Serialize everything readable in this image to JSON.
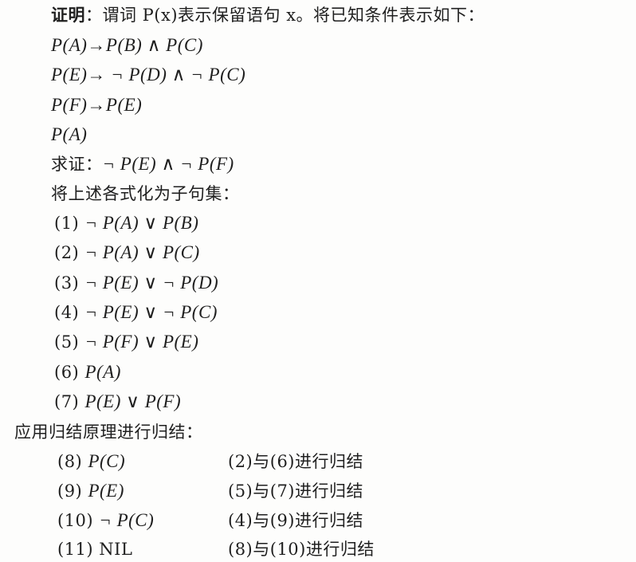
{
  "proof": {
    "heading_label": "证明",
    "heading_text": "：谓词 P(x)表示保留语句 x。将已知条件表示如下：",
    "premises": [
      "P(A)→P(B) ∧ P(C)",
      "P(E)→ ¬ P(D) ∧ ¬ P(C)",
      "P(F)→P(E)",
      "P(A)"
    ],
    "goal_label": "求证：",
    "goal": "¬ P(E) ∧ ¬ P(F)",
    "clause_intro": "将上述各式化为子句集：",
    "clauses": [
      {
        "num": "(1)",
        "expr": "¬ P(A) ∨ P(B)"
      },
      {
        "num": "(2)",
        "expr": "¬ P(A) ∨ P(C)"
      },
      {
        "num": "(3)",
        "expr": "¬ P(E) ∨ ¬ P(D)"
      },
      {
        "num": "(4)",
        "expr": "¬ P(E) ∨ ¬ P(C)"
      },
      {
        "num": "(5)",
        "expr": "¬ P(F) ∨ P(E)"
      },
      {
        "num": "(6)",
        "expr": "P(A)"
      },
      {
        "num": "(7)",
        "expr": "P(E) ∨ P(F)"
      }
    ],
    "resolution_intro": "应用归结原理进行归结：",
    "resolution_steps": [
      {
        "num": "(8)",
        "expr": "P(C)",
        "reason": "(2)与(6)进行归结"
      },
      {
        "num": "(9)",
        "expr": "P(E)",
        "reason": "(5)与(7)进行归结"
      },
      {
        "num": "(10)",
        "expr": "¬ P(C)",
        "reason": "(4)与(9)进行归结"
      },
      {
        "num": "(11)",
        "expr": "NIL",
        "reason": "(8)与(10)进行归结"
      }
    ]
  }
}
